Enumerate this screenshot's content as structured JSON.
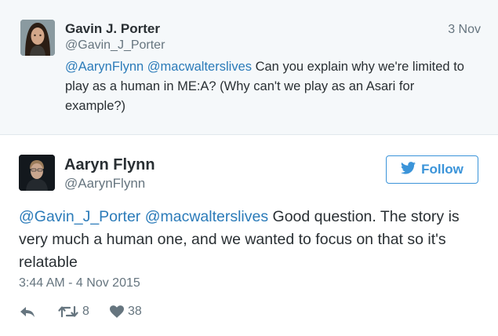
{
  "quoted_tweet": {
    "author_name": "Gavin J. Porter",
    "author_handle": "@Gavin_J_Porter",
    "date": "3 Nov",
    "mentions": [
      "@AarynFlynn",
      "@macwalterslives"
    ],
    "text": "Can you explain why we're limited to play as a human in ME:A? (Why can't we play as an Asari for example?)"
  },
  "main_tweet": {
    "author_name": "Aaryn Flynn",
    "author_handle": "@AarynFlynn",
    "follow_label": "Follow",
    "mentions": [
      "@Gavin_J_Porter",
      "@macwalterslives"
    ],
    "text": "Good question. The story is very much a human one, and we wanted to focus on that so it's relatable",
    "timestamp": "3:44 AM - 4 Nov 2015",
    "retweets": "8",
    "likes": "38",
    "icons": {
      "follow": "bird-icon",
      "reply": "reply-icon",
      "retweet": "retweet-icon",
      "like": "heart-icon"
    }
  },
  "colors": {
    "link": "#2b7bb9",
    "follow_blue": "#3b94d9",
    "secondary_text": "#66757f",
    "quoted_background": "#f5f8fa"
  }
}
